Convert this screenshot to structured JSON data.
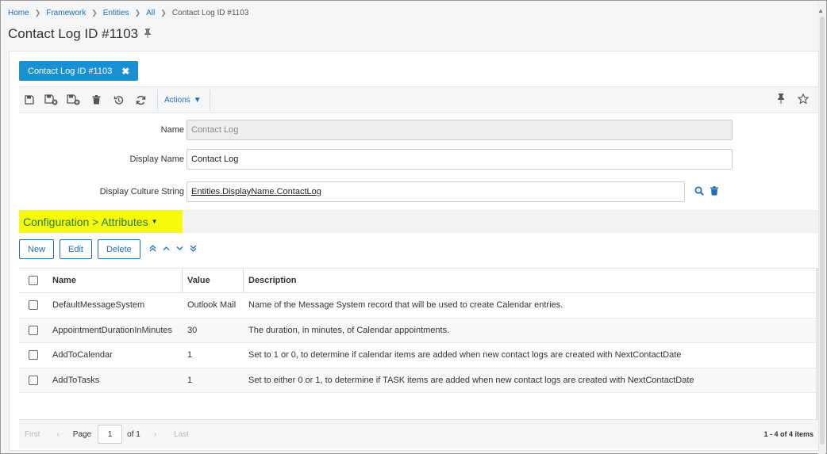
{
  "breadcrumb": {
    "items": [
      "Home",
      "Framework",
      "Entities",
      "All"
    ],
    "current": "Contact Log ID #1103"
  },
  "page": {
    "title": "Contact Log ID #1103"
  },
  "tab": {
    "label": "Contact Log ID #1103"
  },
  "toolbar": {
    "actions_label": "Actions"
  },
  "form": {
    "name_label": "Name",
    "name_value": "Contact Log",
    "display_name_label": "Display Name",
    "display_name_value": "Contact Log",
    "culture_label": "Display Culture String",
    "culture_value": "Entities.DisplayName.ContactLog"
  },
  "section": {
    "title": "Configuration > Attributes"
  },
  "grid_buttons": {
    "new": "New",
    "edit": "Edit",
    "delete": "Delete"
  },
  "grid": {
    "headers": {
      "name": "Name",
      "value": "Value",
      "description": "Description"
    },
    "rows": [
      {
        "name": "DefaultMessageSystem",
        "value": "Outlook Mail",
        "description": "Name of the Message System record that will be used to create Calendar entries."
      },
      {
        "name": "AppointmentDurationInMinutes",
        "value": "30",
        "description": "The duration, in minutes, of Calendar appointments."
      },
      {
        "name": "AddToCalendar",
        "value": "1",
        "description": "Set to 1 or 0, to determine if calendar items are added when new contact logs are created with NextContactDate"
      },
      {
        "name": "AddToTasks",
        "value": "1",
        "description": "Set to either 0 or 1, to determine if TASK items are added when new contact logs are created with NextContactDate"
      }
    ]
  },
  "pager": {
    "first": "First",
    "last": "Last",
    "page_label": "Page",
    "page_value": "1",
    "of_label": "of 1",
    "count": "1 - 4 of 4 items"
  },
  "colors": {
    "accent": "#1a8fd1",
    "link": "#1f6fb3",
    "highlight": "#f6fb0b",
    "section_text": "#2b7a2b"
  }
}
